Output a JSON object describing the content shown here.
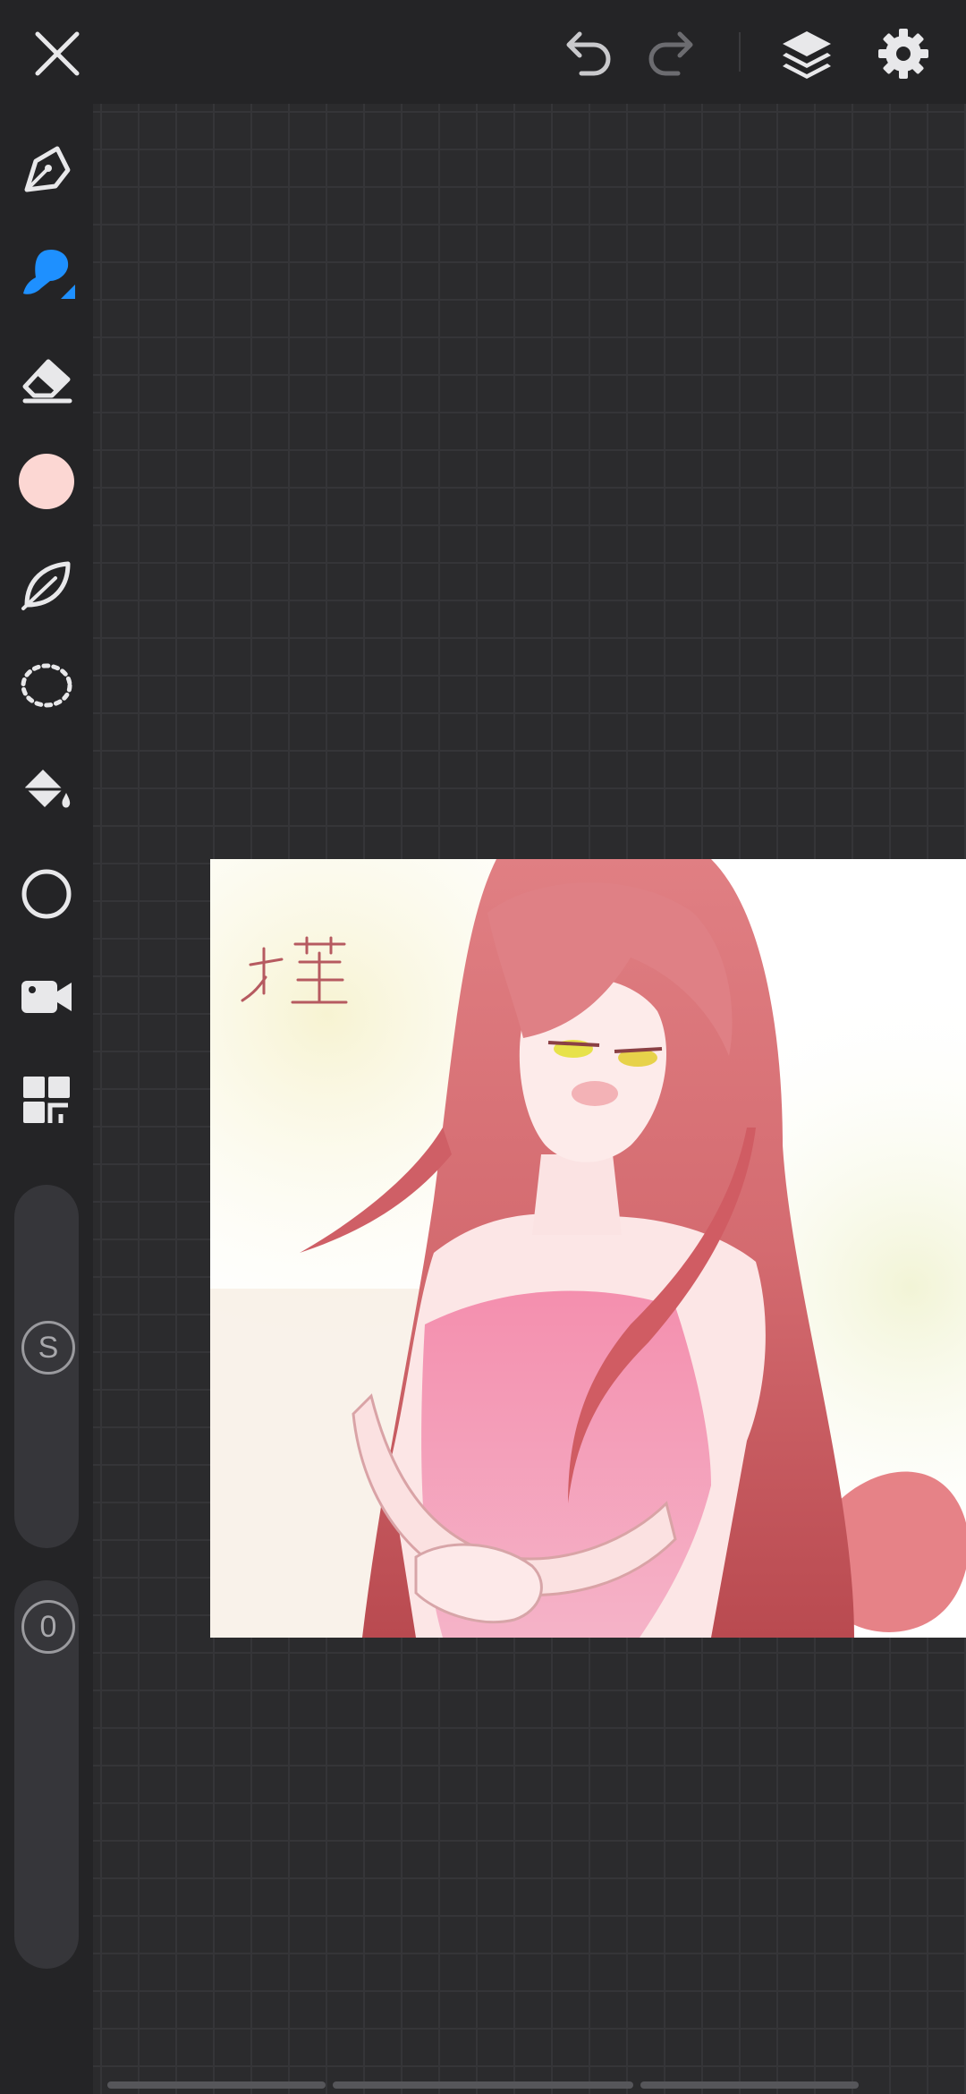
{
  "toolbar": {
    "close": "close-icon",
    "undo": "undo-icon",
    "redo": "redo-icon",
    "layers": "layers-icon",
    "settings": "gear-icon"
  },
  "tools": [
    {
      "name": "pen",
      "icon": "pen-icon"
    },
    {
      "name": "brush",
      "icon": "brush-icon",
      "active": true
    },
    {
      "name": "eraser",
      "icon": "eraser-icon"
    },
    {
      "name": "color",
      "icon": "color-swatch",
      "value": "#fcd7d3"
    },
    {
      "name": "smudge",
      "icon": "leaf-icon"
    },
    {
      "name": "selection",
      "icon": "lasso-icon"
    },
    {
      "name": "fill",
      "icon": "paint-bucket-icon"
    },
    {
      "name": "shape",
      "icon": "circle-icon"
    },
    {
      "name": "record",
      "icon": "video-camera-icon"
    },
    {
      "name": "gallery",
      "icon": "grid-icon"
    }
  ],
  "sliders": {
    "size_label": "S",
    "opacity_label": "0"
  },
  "colors": {
    "accent": "#1e90ff",
    "toolbar_bg": "#242426",
    "canvas_bg": "#2b2b2d",
    "current_color": "#fcd7d3"
  }
}
